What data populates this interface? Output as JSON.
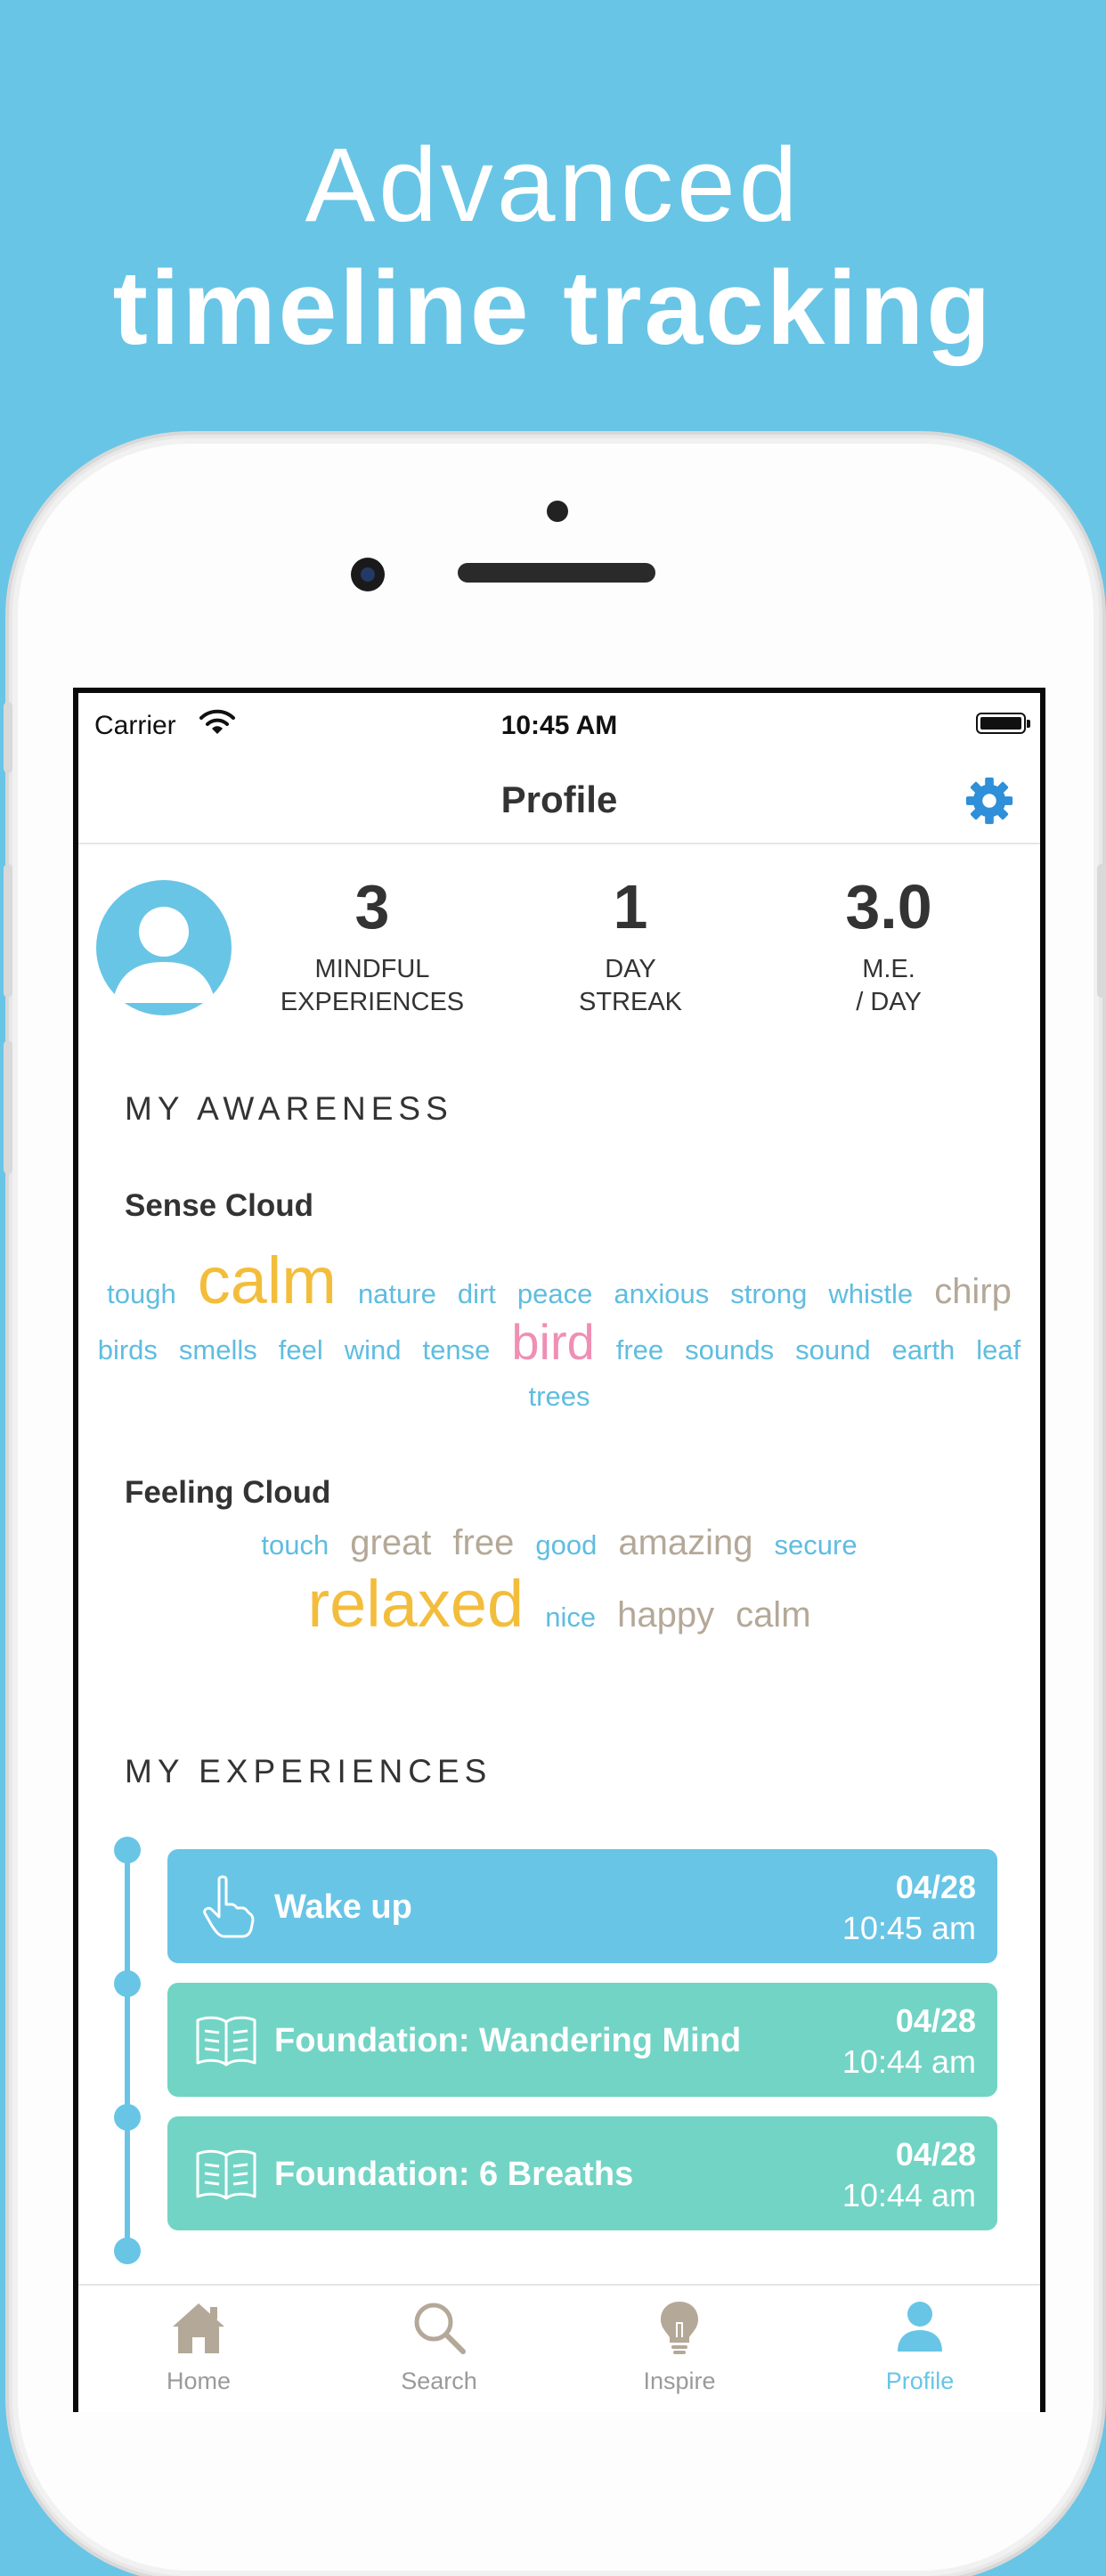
{
  "promo": {
    "line1": "Advanced",
    "line2": "timeline tracking"
  },
  "status_bar": {
    "carrier": "Carrier",
    "time": "10:45 AM"
  },
  "nav": {
    "title": "Profile"
  },
  "stats": [
    {
      "value": "3",
      "label1": "MINDFUL",
      "label2": "EXPERIENCES"
    },
    {
      "value": "1",
      "label1": "DAY",
      "label2": "STREAK"
    },
    {
      "value": "3.0",
      "label1": "M.E.",
      "label2": "/ DAY"
    }
  ],
  "awareness": {
    "heading": "MY AWARENESS",
    "sense_cloud": {
      "title": "Sense Cloud",
      "words": [
        {
          "text": "tough",
          "size": "s",
          "color": "blue"
        },
        {
          "text": "calm",
          "size": "xl",
          "color": "gold"
        },
        {
          "text": "nature",
          "size": "s",
          "color": "blue"
        },
        {
          "text": "dirt",
          "size": "s",
          "color": "blue"
        },
        {
          "text": "peace",
          "size": "s",
          "color": "blue"
        },
        {
          "text": "anxious",
          "size": "s",
          "color": "blue"
        },
        {
          "text": "strong",
          "size": "s",
          "color": "blue"
        },
        {
          "text": "whistle",
          "size": "s",
          "color": "blue"
        },
        {
          "text": "chirp",
          "size": "m",
          "color": "tan"
        },
        {
          "text": "birds",
          "size": "s",
          "color": "blue"
        },
        {
          "text": "smells",
          "size": "s",
          "color": "blue"
        },
        {
          "text": "feel",
          "size": "s",
          "color": "blue"
        },
        {
          "text": "wind",
          "size": "s",
          "color": "blue"
        },
        {
          "text": "tense",
          "size": "s",
          "color": "blue"
        },
        {
          "text": "bird",
          "size": "l",
          "color": "pink"
        },
        {
          "text": "free",
          "size": "s",
          "color": "blue"
        },
        {
          "text": "sounds",
          "size": "s",
          "color": "blue"
        },
        {
          "text": "sound",
          "size": "s",
          "color": "blue"
        },
        {
          "text": "earth",
          "size": "s",
          "color": "blue"
        },
        {
          "text": "leaf",
          "size": "s",
          "color": "blue"
        },
        {
          "text": "trees",
          "size": "s",
          "color": "blue"
        }
      ]
    },
    "feeling_cloud": {
      "title": "Feeling Cloud",
      "words": [
        {
          "text": "touch",
          "size": "s",
          "color": "blue"
        },
        {
          "text": "great",
          "size": "m",
          "color": "tan"
        },
        {
          "text": "free",
          "size": "m",
          "color": "tan"
        },
        {
          "text": "good",
          "size": "s",
          "color": "blue"
        },
        {
          "text": "amazing",
          "size": "m",
          "color": "tan"
        },
        {
          "text": "secure",
          "size": "s",
          "color": "blue"
        },
        {
          "text": "relaxed",
          "size": "xl",
          "color": "gold"
        },
        {
          "text": "nice",
          "size": "s",
          "color": "blue"
        },
        {
          "text": "happy",
          "size": "m",
          "color": "tan"
        },
        {
          "text": "calm",
          "size": "m",
          "color": "tan"
        }
      ]
    }
  },
  "experiences": {
    "heading": "MY EXPERIENCES",
    "items": [
      {
        "title": "Wake up",
        "date": "04/28",
        "time": "10:45 am",
        "icon": "hand-pointer-icon",
        "color": "#68c5e6"
      },
      {
        "title": "Foundation: Wandering Mind",
        "date": "04/28",
        "time": "10:44 am",
        "icon": "book-icon",
        "color": "#72d4c5"
      },
      {
        "title": "Foundation: 6 Breaths",
        "date": "04/28",
        "time": "10:44 am",
        "icon": "book-icon",
        "color": "#72d4c5"
      }
    ]
  },
  "tabs": [
    {
      "label": "Home",
      "icon": "home-icon",
      "active": false
    },
    {
      "label": "Search",
      "icon": "search-icon",
      "active": false
    },
    {
      "label": "Inspire",
      "icon": "lightbulb-icon",
      "active": false
    },
    {
      "label": "Profile",
      "icon": "profile-icon",
      "active": true
    }
  ],
  "colors": {
    "background": "#68c5e6",
    "accent": "#68c5e6",
    "teal": "#72d4c5",
    "gold": "#f3bd3c",
    "tan": "#b4a898",
    "pink": "#ef8fb4",
    "tab_inactive": "#9a9a9a",
    "gear": "#2f8fd8"
  }
}
